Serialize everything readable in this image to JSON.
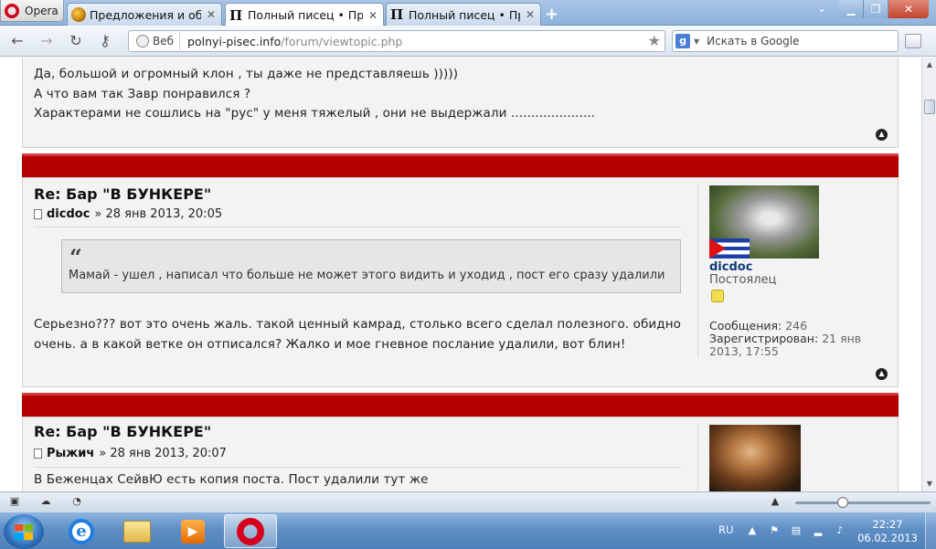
{
  "browser": {
    "menu_label": "Opera",
    "tabs": [
      {
        "title": "Предложения и обсу..."
      },
      {
        "title": "Полный писец • Прос..."
      },
      {
        "title": "Полный писец • Прос..."
      }
    ],
    "address": {
      "mode_label": "Веб",
      "host": "polnyi-pisec.info",
      "path": "/forum/viewtopic.php"
    },
    "search": {
      "placeholder": "Искать в Google"
    }
  },
  "forum": {
    "prev_post": {
      "lines": [
        "Да, большой и огромный клон , ты даже не представляешь )))))",
        "А что вам так Завр понравился ?",
        "Характерами не сошлись на \"рус\" у меня тяжелый , они не выдержали ....................."
      ]
    },
    "posts": [
      {
        "title": "Re: Бар \"В БУНКЕРЕ\"",
        "author": "dicdoc",
        "date": "» 28 янв 2013, 20:05",
        "quote": "Мамай - ушел , написал что больше не может этого видить и уходид , пост его сразу удалили",
        "lines": [
          "Серьезно??? вот это очень жаль. такой ценный камрад, столько всего сделал полезного. обидно",
          "очень. а в какой ветке он отписался? Жалко и мое гневное послание удалили, вот блин!"
        ],
        "profile": {
          "username": "dicdoc",
          "rank": "Постоялец",
          "posts_label": "Сообщения:",
          "posts_value": "246",
          "reg_label": "Зарегистрирован:",
          "reg_value_1": "21 янв",
          "reg_value_2": "2013, 17:55"
        }
      },
      {
        "title": "Re: Бар \"В БУНКЕРЕ\"",
        "author": "Рыжич",
        "date": "» 28 янв 2013, 20:07",
        "lines": [
          "В Беженцах СейвЮ есть копия поста. Пост удалили тут же"
        ]
      }
    ]
  },
  "taskbar": {
    "language": "RU",
    "time": "22:27",
    "date": "06.02.2013"
  },
  "colors": {
    "post_header_red": "#b50000",
    "post_bg": "#f3f3f3",
    "username_blue": "#103a7a"
  }
}
